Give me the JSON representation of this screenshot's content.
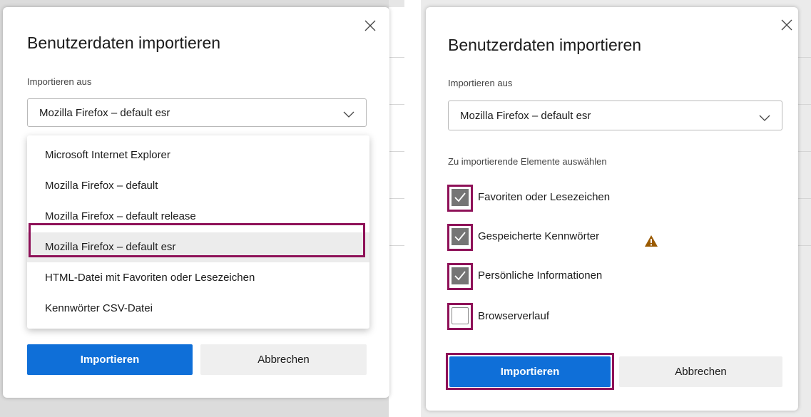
{
  "left_dialog": {
    "title": "Benutzerdaten importieren",
    "import_from_label": "Importieren aus",
    "selected_source": "Mozilla Firefox – default esr",
    "options": [
      "Microsoft Internet Explorer",
      "Mozilla Firefox – default",
      "Mozilla Firefox – default release",
      "Mozilla Firefox – default esr",
      "HTML-Datei mit Favoriten oder Lesezeichen",
      "Kennwörter CSV-Datei"
    ],
    "import_button": "Importieren",
    "cancel_button": "Abbrechen"
  },
  "right_dialog": {
    "title": "Benutzerdaten importieren",
    "import_from_label": "Importieren aus",
    "selected_source": "Mozilla Firefox – default esr",
    "items_label": "Zu importierende Elemente auswählen",
    "items": [
      {
        "label": "Favoriten oder Lesezeichen",
        "checked": true
      },
      {
        "label": "Gespeicherte Kennwörter",
        "checked": true
      },
      {
        "label": "Persönliche Informationen",
        "checked": true
      },
      {
        "label": "Browserverlauf",
        "checked": false
      }
    ],
    "import_button": "Importieren",
    "cancel_button": "Abbrechen"
  },
  "icons": {
    "close": "close-icon",
    "chevron": "chevron-down-icon",
    "check": "checkmark-icon",
    "warning": "warning-icon"
  },
  "colors": {
    "highlight": "#8e1158",
    "primary": "#0f6fd8",
    "checkbox": "#757575",
    "warning": "#9a5a00"
  }
}
